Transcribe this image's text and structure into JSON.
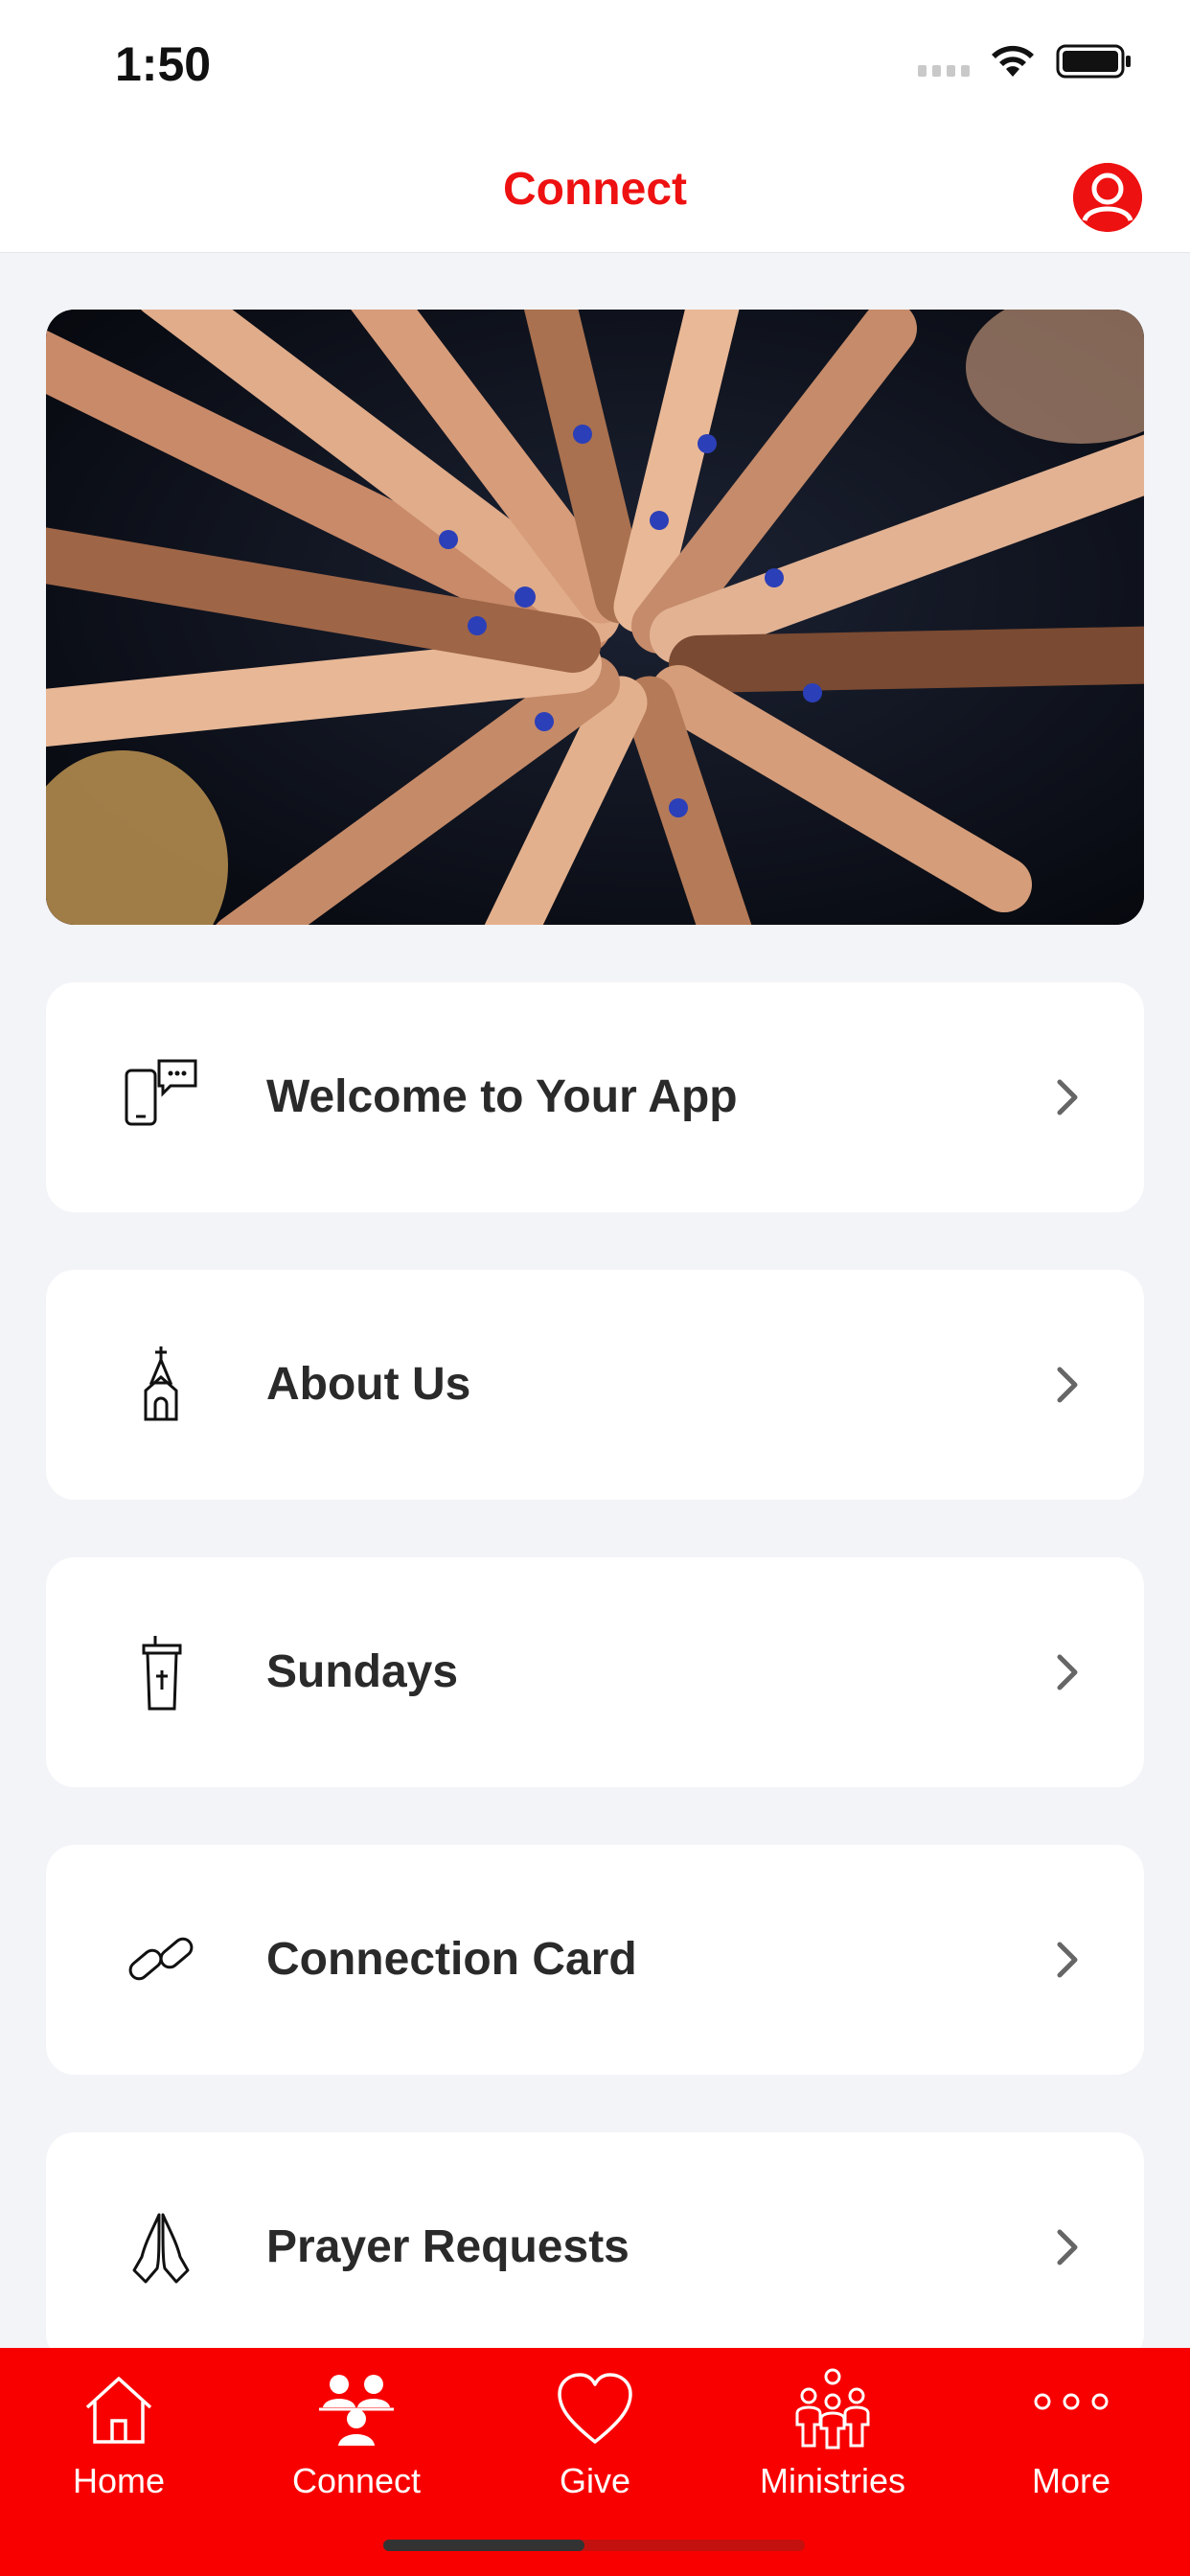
{
  "status_bar": {
    "time": "1:50"
  },
  "header": {
    "title": "Connect",
    "profile_icon": "person-circle-icon"
  },
  "colors": {
    "accent": "#ee1111",
    "tab_bar_bg": "#f90000",
    "page_bg": "#f3f4f8"
  },
  "menu": [
    {
      "label": "Welcome to Your App",
      "icon": "phone-chat-icon"
    },
    {
      "label": "About Us",
      "icon": "church-icon"
    },
    {
      "label": "Sundays",
      "icon": "pulpit-icon"
    },
    {
      "label": "Connection Card",
      "icon": "link-icon"
    },
    {
      "label": "Prayer Requests",
      "icon": "praying-hands-icon"
    }
  ],
  "tabs": [
    {
      "label": "Home",
      "icon": "home-icon"
    },
    {
      "label": "Connect",
      "icon": "people-icon",
      "selected": true
    },
    {
      "label": "Give",
      "icon": "heart-icon"
    },
    {
      "label": "Ministries",
      "icon": "group-icon"
    },
    {
      "label": "More",
      "icon": "more-dots-icon"
    }
  ]
}
